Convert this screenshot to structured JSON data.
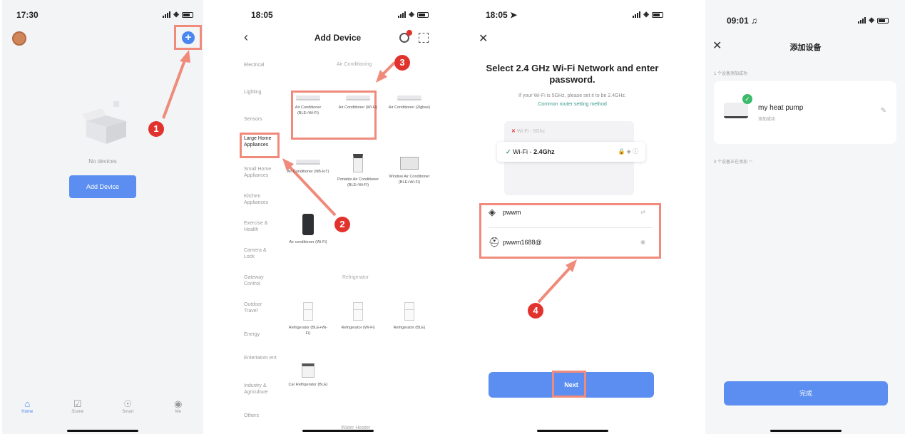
{
  "screen1": {
    "time": "17:30",
    "empty_text": "No devices",
    "add_button": "Add Device",
    "tabs": [
      "Home",
      "Scene",
      "Smart",
      "Me"
    ],
    "step": "1"
  },
  "screen2": {
    "time": "18:05",
    "title": "Add Device",
    "categories": [
      "Electrical",
      "Lighting",
      "Sensors",
      "Large Home Appliances",
      "Small Home Appliances",
      "Kitchen Appliances",
      "Exercise & Health",
      "Camera & Lock",
      "Gateway Control",
      "Outdoor Travel",
      "Energy",
      "Entertainm ent",
      "Industry & Agriculture",
      "Others"
    ],
    "section_ac": "Air Conditioning",
    "section_fridge": "Refrigerator",
    "section_water": "Water Heater",
    "ac_devices": [
      "Air Conditioner (BLE+Wi-Fi)",
      "Air Conditioner (Wi-Fi)",
      "Air Conditioner (Zigbee)",
      "Air Conditioner (NB-IoT)",
      "Portable Air Conditioner (BLE+Wi-Fi)",
      "Window Air Conditioner (BLE+Wi-Fi)",
      "Air conditioner (Wi-Fi)"
    ],
    "fridge_devices": [
      "Refrigerator (BLE+Wi-Fi)",
      "Refrigerator (Wi-Fi)",
      "Refrigerator (BLE)",
      "Car Refrigerator (BLE)"
    ],
    "steps": [
      "2",
      "3"
    ]
  },
  "screen3": {
    "time": "18:05",
    "title": "Select 2.4 GHz Wi-Fi Network and enter password.",
    "subtitle": "If your Wi-Fi is 5GHz, please set it to be 2.4GHz.",
    "link": "Common router setting method",
    "network_bad": "Wi-Fi - 5Ghz",
    "network_good_prefix": "Wi-Fi - ",
    "network_good_band": "2.4Ghz",
    "ssid": "pwwm",
    "password": "pwwm1688@",
    "next_button": "Next",
    "step": "4"
  },
  "screen4": {
    "time": "09:01",
    "title": "添加设备",
    "success_count": "1 个设备添加成功",
    "device_name": "my heat pump",
    "device_status": "添加成功",
    "adding_count": "0 个设备正在添加",
    "done_button": "完成"
  }
}
